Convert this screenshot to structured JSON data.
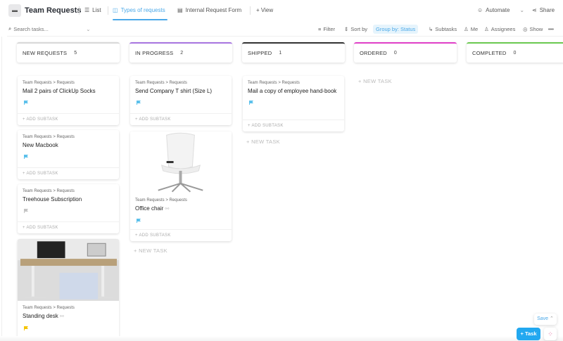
{
  "header": {
    "title": "Team Requests",
    "tabs": [
      {
        "label": "List"
      },
      {
        "label": "Types of requests"
      },
      {
        "label": "Internal Request Form"
      }
    ],
    "add_view": "+ View",
    "automate": "Automate",
    "share": "Share"
  },
  "toolbar": {
    "search_placeholder": "Search tasks...",
    "filter": "Filter",
    "sort": "Sort by",
    "group": "Group by: Status",
    "subtasks": "Subtasks",
    "me": "Me",
    "assignees": "Assignees",
    "show": "Show",
    "more": "•••"
  },
  "columns": [
    {
      "name": "NEW REQUESTS",
      "count": "5",
      "color": "#d8d8d8"
    },
    {
      "name": "IN PROGRESS",
      "count": "2",
      "color": "#a875e0"
    },
    {
      "name": "SHIPPED",
      "count": "1",
      "color": "#333333"
    },
    {
      "name": "ORDERED",
      "count": "0",
      "color": "#e040c8"
    },
    {
      "name": "COMPLETED",
      "count": "0",
      "color": "#6bc950"
    }
  ],
  "crumb": "Team Requests  >  Requests",
  "tasks": [
    {
      "title": "Mail 2 pairs of ClickUp Socks",
      "flag": "#5bc0eb"
    },
    {
      "title": "New Macbook",
      "flag": "#5bc0eb"
    },
    {
      "title": "Treehouse Subscription",
      "flag": "#c4c4c4"
    },
    {
      "title": "Standing desk",
      "flag": "#f5c400"
    },
    {
      "title": "Send Company T shirt (Size L)",
      "flag": "#5bc0eb"
    },
    {
      "title": "Office chair",
      "flag": "#5bc0eb"
    },
    {
      "title": "Mail a copy of employee hand-book",
      "flag": "#5bc0eb"
    }
  ],
  "add_subtask": "+ ADD SUBTASK",
  "new_task": "+ NEW TASK",
  "fab": {
    "save": "Save",
    "task": "+ Task"
  }
}
